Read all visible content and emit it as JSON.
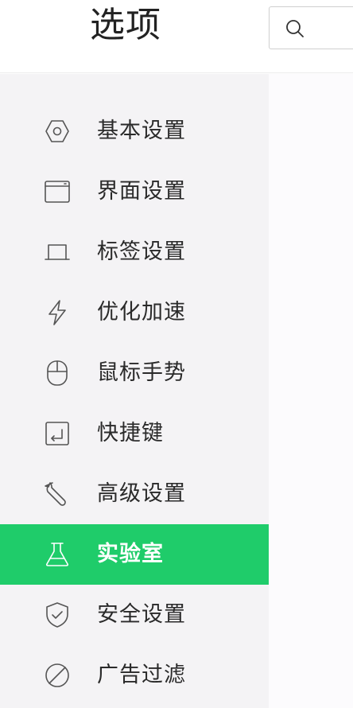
{
  "header": {
    "title": "选项",
    "search_placeholder": "",
    "search_value": ""
  },
  "sidebar": {
    "items": [
      {
        "label": "基本设置",
        "icon": "hexagon-icon",
        "active": false
      },
      {
        "label": "界面设置",
        "icon": "window-icon",
        "active": false
      },
      {
        "label": "标签设置",
        "icon": "tab-icon",
        "active": false
      },
      {
        "label": "优化加速",
        "icon": "lightning-icon",
        "active": false
      },
      {
        "label": "鼠标手势",
        "icon": "mouse-icon",
        "active": false
      },
      {
        "label": "快捷键",
        "icon": "keyboard-icon",
        "active": false
      },
      {
        "label": "高级设置",
        "icon": "wrench-icon",
        "active": false
      },
      {
        "label": "实验室",
        "icon": "flask-icon",
        "active": true
      },
      {
        "label": "安全设置",
        "icon": "shield-icon",
        "active": false
      },
      {
        "label": "广告过滤",
        "icon": "block-icon",
        "active": false
      }
    ]
  },
  "colors": {
    "accent": "#1fcc6a",
    "sidebar_bg": "#f4f3f5",
    "text": "#2a2a2a"
  }
}
